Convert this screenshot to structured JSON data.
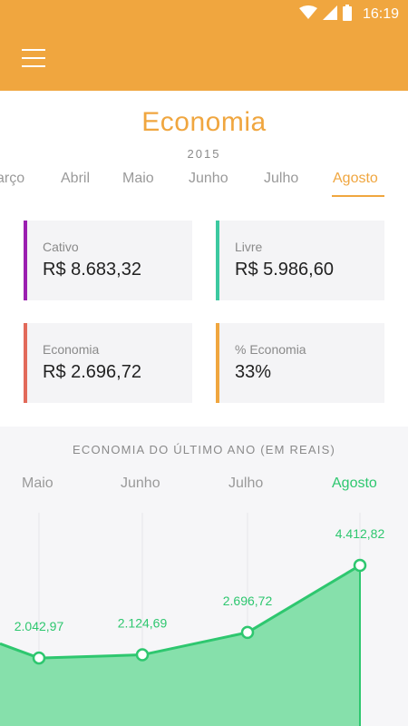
{
  "status_bar": {
    "time": "16:19",
    "icons": [
      "wifi-icon",
      "cell-signal-icon",
      "battery-icon"
    ]
  },
  "app_bar": {
    "menu_icon": "hamburger-menu-icon",
    "color": "#f0a63f"
  },
  "header": {
    "title": "Economia",
    "year": "2015"
  },
  "months": [
    {
      "label": "Março",
      "display": "arço",
      "active": false
    },
    {
      "label": "Abril",
      "active": false
    },
    {
      "label": "Maio",
      "active": false
    },
    {
      "label": "Junho",
      "active": false
    },
    {
      "label": "Julho",
      "active": false
    },
    {
      "label": "Agosto",
      "active": true
    }
  ],
  "cards": [
    {
      "label": "Cativo",
      "value": "R$ 8.683,32",
      "accent": "#9b1fb0"
    },
    {
      "label": "Livre",
      "value": "R$ 5.986,60",
      "accent": "#3cc9a0"
    },
    {
      "label": "Economia",
      "value": "R$ 2.696,72",
      "accent": "#e26a5a"
    },
    {
      "label": "% Economia",
      "value": "33%",
      "accent": "#f0a63f"
    }
  ],
  "chart": {
    "title": "ECONOMIA DO ÚLTIMO ANO (EM REAIS)",
    "months": [
      "Maio",
      "Junho",
      "Julho",
      "Agosto"
    ],
    "active_month": "Agosto",
    "line_color": "#2ec76f",
    "fill_color": "#86e0ab"
  },
  "chart_data": {
    "type": "area",
    "categories": [
      "Maio",
      "Junho",
      "Julho",
      "Agosto"
    ],
    "values": [
      2042.97,
      2124.69,
      2696.72,
      4412.82
    ],
    "labels": [
      "2.042,97",
      "2.124,69",
      "2.696,72",
      "4.412,82"
    ],
    "title": "ECONOMIA DO ÚLTIMO ANO (EM REAIS)"
  }
}
